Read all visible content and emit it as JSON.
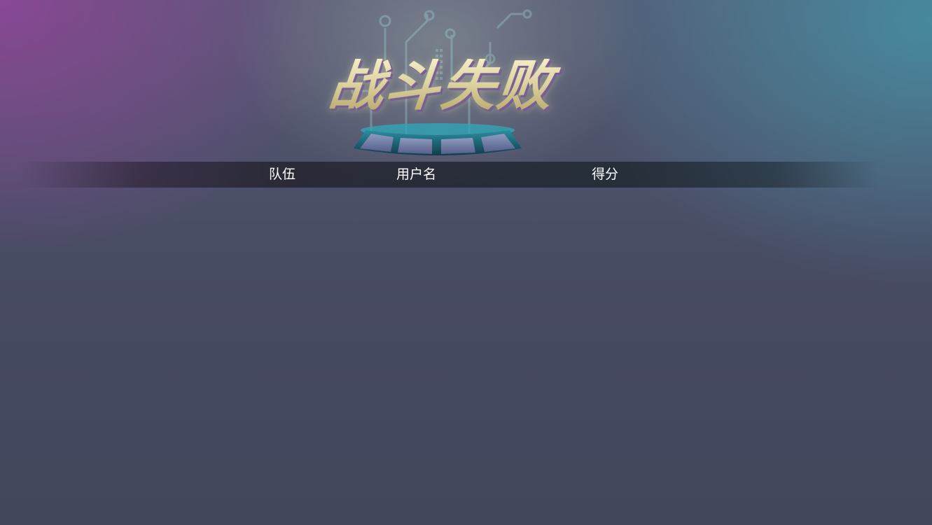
{
  "result": {
    "title": "战斗失败"
  },
  "table": {
    "columns": {
      "team": "队伍",
      "username": "用户名",
      "score": "得分"
    },
    "rows": []
  },
  "colors": {
    "title_fill": "#e4dbb0",
    "title_shadow": "#785a96",
    "pedestal": "#1f5c6e",
    "pedestal_panel": "#6f7aa0"
  },
  "icons": {
    "circuit": "circuit-board-icon",
    "pedestal": "pedestal-icon"
  }
}
